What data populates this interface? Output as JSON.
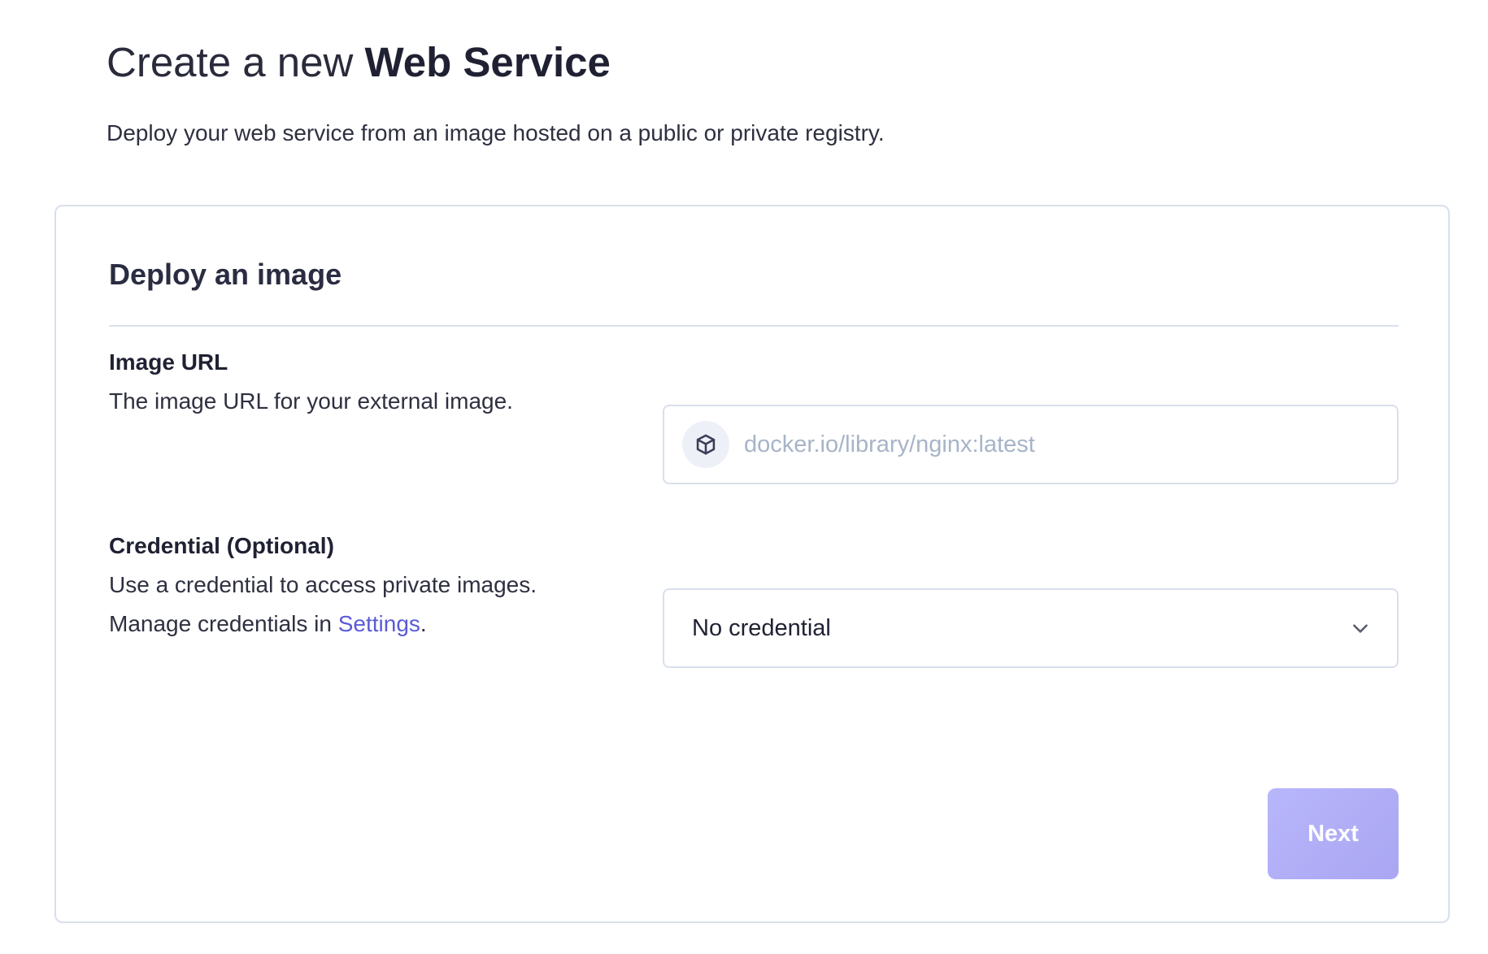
{
  "header": {
    "title_prefix": "Create a new ",
    "title_strong": "Web Service",
    "subtitle": "Deploy your web service from an image hosted on a public or private registry."
  },
  "card": {
    "title": "Deploy an image",
    "image_url": {
      "label": "Image URL",
      "help": "The image URL for your external image.",
      "placeholder": "docker.io/library/nginx:latest",
      "value": "",
      "icon": "package-icon"
    },
    "credential": {
      "label": "Credential (Optional)",
      "help": "Use a credential to access private images.",
      "manage_prefix": "Manage credentials in ",
      "manage_link": "Settings",
      "manage_suffix": ".",
      "selected": "No credential",
      "icon": "chevron-down-icon"
    },
    "next_button": {
      "label": "Next",
      "enabled": false
    }
  },
  "colors": {
    "accent_link": "#5b5bd6",
    "button_disabled": "#b1aef6",
    "border": "#d8e0ea",
    "placeholder": "#a7b4c8"
  }
}
